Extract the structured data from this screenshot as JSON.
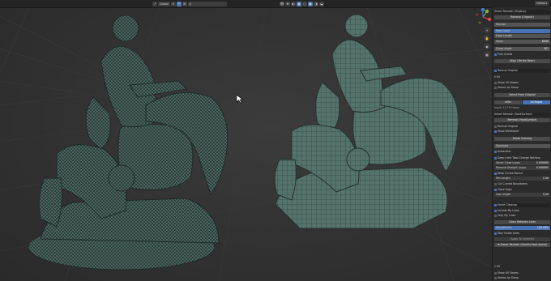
{
  "header": {
    "mode_label": "Global",
    "search_placeholder": "",
    "panel_tab": "Options"
  },
  "gizmo": {
    "axes": [
      "X",
      "Y",
      "Z"
    ],
    "colors": {
      "x": "#e0414b",
      "y": "#7fbb3a",
      "z": "#3f7fd9"
    }
  },
  "panel": {
    "title": "Smart Remesh (Organic)",
    "remesh_button": "Remesh (Organic)",
    "method": "Manual",
    "face_count": "Face Count",
    "edge_length": "Edge Length",
    "faces_label": "Faces",
    "faces_value": "8000",
    "sharp_angle_label": "Sharp Angle",
    "sharp_angle_value": "30°",
    "pure_quads": "Pure Quads",
    "align_button": "Align (Vertex Base)",
    "rescue_original": "Rescue Original",
    "uv_label": "UV",
    "show_uv_seams": "Show UV Seams",
    "seams_as_sharp": "Seams As Sharp",
    "select_from_original": "Select From Original",
    "mode_a": "aMix",
    "mode_b": "All Edges",
    "info": "Input: 11,719 faces",
    "smart_remesh_hardsurface": "Smart Remesh (HardSurface)",
    "remesh_hardsurface_button": "Remesh (HardSurface)",
    "rescue_original_2": "Rescue Original",
    "show_wireframe": "Show Wireframe",
    "reset_coloring": "Reset Coloring",
    "decimate": "Decimate",
    "automatic": "Automatic",
    "opt_a": "Deep Limit Total Change Nothing",
    "opt_b": "Smart Close Loops",
    "opt_b_val": "0.000000",
    "opt_c": "Remove Straight Loops",
    "opt_c_val": "0.000000",
    "keep_circles_round": "Keep Circles Round",
    "min_length": "Min Length",
    "min_length_val": "1.00",
    "cut_curved_boundaries": "Cut Curved Boundaries",
    "close_gaps": "Close Gaps",
    "gap_length": "Gap Length",
    "gap_length_val": "5.00",
    "smart_cleanup": "Smart Cleanup",
    "include_my_lines": "Include My Lines",
    "only_my_lines": "Only My Lines",
    "clean_between_lines": "Clean Between Lines",
    "smoothness": "Smoothness",
    "smoothness_val": "130.00%",
    "stay_inside_lines": "Stay Inside Lines",
    "apply_to_selected": "Apply To Selected",
    "re_smart": "re-Smart Remesh (HardSurface above)",
    "uv_label_2": "UV",
    "show_uv_seams_2": "Show UV Seams",
    "seams_as_sharp_2": "Seams As Sharp"
  }
}
